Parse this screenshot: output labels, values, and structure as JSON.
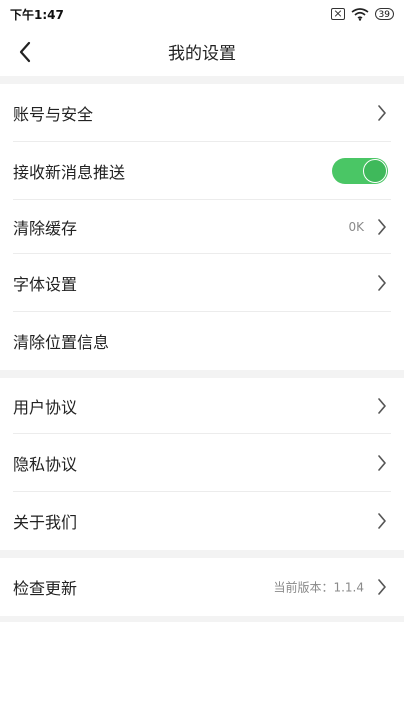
{
  "status_bar": {
    "time": "下午1:47",
    "battery": "39",
    "icons": [
      "close-box-icon",
      "wifi-icon",
      "battery-icon"
    ]
  },
  "nav": {
    "title": "我的设置",
    "back_icon": "chevron-left-icon"
  },
  "settings": {
    "account_security": "账号与安全",
    "push_notifications": "接收新消息推送",
    "push_enabled": true,
    "clear_cache": "清除缓存",
    "cache_size": "0K",
    "font_settings": "字体设置",
    "clear_location": "清除位置信息",
    "user_agreement": "用户协议",
    "privacy_agreement": "隐私协议",
    "about_us": "关于我们",
    "check_update": "检查更新",
    "current_version": "当前版本：1.1.4"
  },
  "colors": {
    "toggle_on": "#4ac665",
    "section_gap": "#f3f3f3",
    "divider": "#ececec"
  }
}
